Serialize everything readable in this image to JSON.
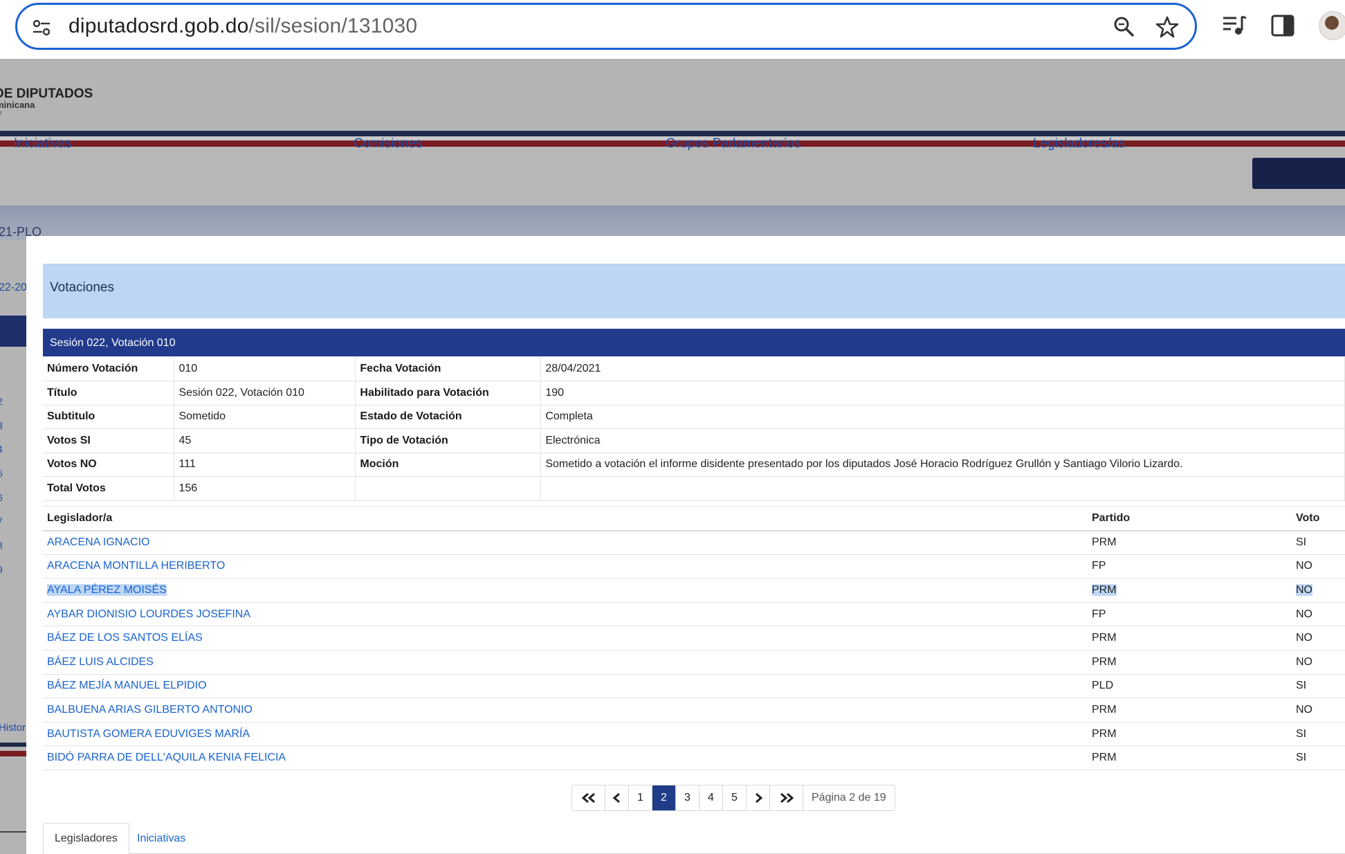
{
  "browser": {
    "url_host": "diputadosrd.gob.do",
    "url_path": "/sil/sesion/131030"
  },
  "site": {
    "brand_title": "DE DIPUTADOS",
    "brand_sub": "minicana",
    "brand_sub2": "z",
    "nav": [
      "Iniciativas",
      "Comisiones",
      "Grupos Parlamentarios",
      "Legisladores/as"
    ],
    "subhead": "21-PLO",
    "side_text": "22-20",
    "side_numbers": [
      "2",
      "3",
      "4",
      "5",
      "6",
      "7",
      "8",
      "9"
    ],
    "side_hist": "Histori"
  },
  "modal": {
    "header": "Votaciones",
    "session_title": "Sesión 022, Votación 010",
    "details": [
      {
        "l1": "Número Votación",
        "v1": "010",
        "l2": "Fecha Votación",
        "v2": "28/04/2021"
      },
      {
        "l1": "Título",
        "v1": "Sesión 022, Votación 010",
        "l2": "Habilitado para Votación",
        "v2": "190"
      },
      {
        "l1": "Subtitulo",
        "v1": "Sometido",
        "l2": "Estado de Votación",
        "v2": "Completa"
      },
      {
        "l1": "Votos SI",
        "v1": "45",
        "l2": "Tipo de Votación",
        "v2": "Electrónica"
      },
      {
        "l1": "Votos NO",
        "v1": "111",
        "l2": "Moción",
        "v2": "Sometido a votación el informe disidente presentado por los diputados José Horacio Rodríguez Grullón y Santiago Vilorio Lizardo."
      },
      {
        "l1": "Total Votos",
        "v1": "156",
        "l2": "",
        "v2": ""
      }
    ],
    "legislators_columns": [
      "Legislador/a",
      "Partido",
      "Voto"
    ],
    "legislators": [
      {
        "name": "ARACENA IGNACIO",
        "party": "PRM",
        "vote": "SI"
      },
      {
        "name": "ARACENA MONTILLA HERIBERTO",
        "party": "FP",
        "vote": "NO"
      },
      {
        "name": "AYALA PÉREZ MOISÉS",
        "party": "PRM",
        "vote": "NO"
      },
      {
        "name": "AYBAR DIONISIO LOURDES JOSEFINA",
        "party": "FP",
        "vote": "NO"
      },
      {
        "name": "BÁEZ DE LOS SANTOS ELÍAS",
        "party": "PRM",
        "vote": "NO"
      },
      {
        "name": "BÁEZ LUIS ALCIDES",
        "party": "PRM",
        "vote": "NO"
      },
      {
        "name": "BÁEZ MEJÍA MANUEL ELPIDIO",
        "party": "PLD",
        "vote": "SI"
      },
      {
        "name": "BALBUENA ARIAS GILBERTO ANTONIO",
        "party": "PRM",
        "vote": "NO"
      },
      {
        "name": "BAUTISTA GOMERA EDUVIGES MARÍA",
        "party": "PRM",
        "vote": "SI"
      },
      {
        "name": "BIDÓ PARRA DE DELL'AQUILA KENIA FELICIA",
        "party": "PRM",
        "vote": "SI"
      }
    ],
    "highlighted_row": 2,
    "pagination": {
      "pages": [
        "1",
        "2",
        "3",
        "4",
        "5"
      ],
      "current": "2",
      "info": "Página 2 de 19"
    },
    "tabs": [
      "Legisladores",
      "Iniciativas"
    ]
  }
}
